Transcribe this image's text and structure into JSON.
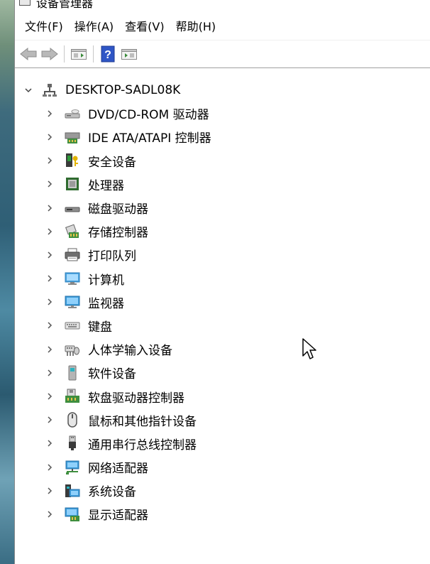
{
  "window": {
    "title": "设备管理器"
  },
  "menu": [
    {
      "label": "文件(F)",
      "name": "menu-file"
    },
    {
      "label": "操作(A)",
      "name": "menu-action"
    },
    {
      "label": "查看(V)",
      "name": "menu-view"
    },
    {
      "label": "帮助(H)",
      "name": "menu-help"
    }
  ],
  "toolbar": {
    "buttons": [
      "back-icon",
      "forward-icon",
      "properties-icon",
      "help-icon",
      "run-icon"
    ]
  },
  "tree": {
    "root": "DESKTOP-SADL08K",
    "items": [
      {
        "label": "DVD/CD-ROM 驱动器",
        "icon": "dvd-drive-icon"
      },
      {
        "label": "IDE ATA/ATAPI 控制器",
        "icon": "ide-controller-icon"
      },
      {
        "label": "安全设备",
        "icon": "security-device-icon"
      },
      {
        "label": "处理器",
        "icon": "processor-icon"
      },
      {
        "label": "磁盘驱动器",
        "icon": "disk-drive-icon"
      },
      {
        "label": "存储控制器",
        "icon": "storage-controller-icon"
      },
      {
        "label": "打印队列",
        "icon": "printer-icon"
      },
      {
        "label": "计算机",
        "icon": "computer-icon"
      },
      {
        "label": "监视器",
        "icon": "monitor-icon"
      },
      {
        "label": "键盘",
        "icon": "keyboard-icon"
      },
      {
        "label": "人体学输入设备",
        "icon": "hid-icon"
      },
      {
        "label": "软件设备",
        "icon": "software-device-icon"
      },
      {
        "label": "软盘驱动器控制器",
        "icon": "floppy-controller-icon"
      },
      {
        "label": "鼠标和其他指针设备",
        "icon": "mouse-icon"
      },
      {
        "label": "通用串行总线控制器",
        "icon": "usb-icon"
      },
      {
        "label": "网络适配器",
        "icon": "network-adapter-icon"
      },
      {
        "label": "系统设备",
        "icon": "system-device-icon"
      },
      {
        "label": "显示适配器",
        "icon": "display-adapter-icon"
      }
    ]
  }
}
